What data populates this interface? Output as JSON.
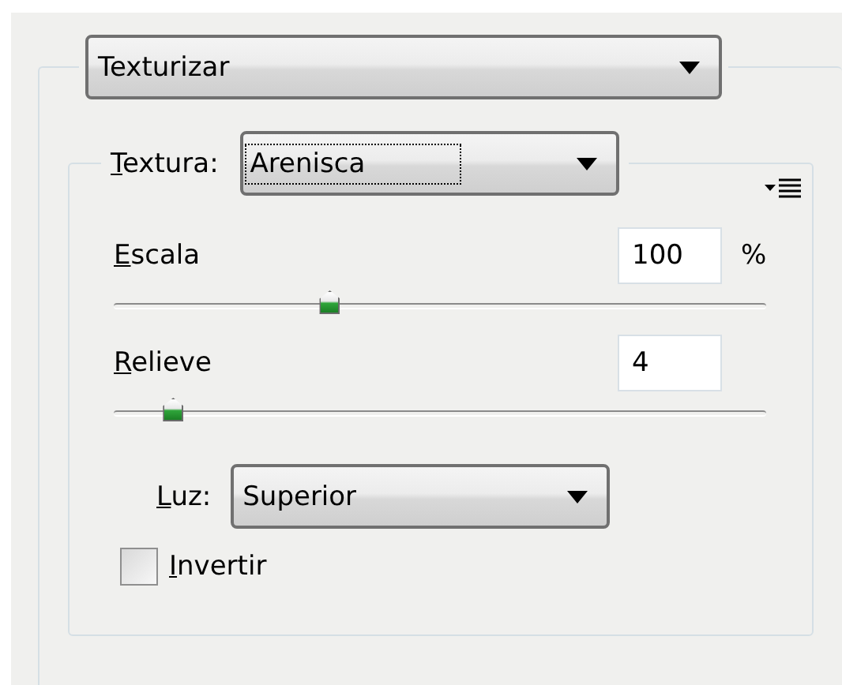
{
  "filter_select": {
    "value": "Texturizar"
  },
  "texture": {
    "label": "Textura:",
    "value": "Arenisca"
  },
  "sliders": [
    {
      "label": "Escala",
      "value": "100",
      "unit": "%",
      "level": 0.33
    },
    {
      "label": "Relieve",
      "value": "4",
      "level": 0.09
    }
  ],
  "light": {
    "label": "Luz:",
    "value": "Superior"
  },
  "invert": {
    "label": "Invertir",
    "checked": false
  }
}
